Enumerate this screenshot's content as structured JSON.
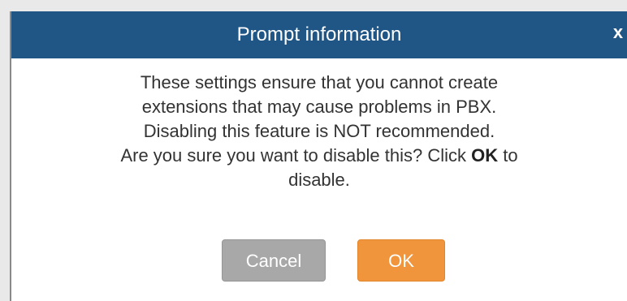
{
  "dialog": {
    "title": "Prompt information",
    "close_label": "x",
    "message": {
      "line1": "These settings ensure that you cannot create",
      "line2": "extensions that may cause problems in PBX.",
      "line3": "Disabling this feature is NOT recommended.",
      "line4_before": "Are you sure you want to disable this? Click ",
      "line4_bold": "OK",
      "line4_after": " to",
      "line5": "disable."
    },
    "buttons": {
      "cancel_label": "Cancel",
      "ok_label": "OK"
    }
  },
  "colors": {
    "titlebar": "#1f5686",
    "ok_button": "#f0953c",
    "cancel_button": "#a8a8a8",
    "text": "#333333"
  }
}
